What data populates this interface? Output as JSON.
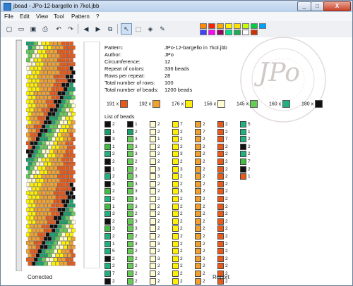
{
  "window": {
    "title": "jbead - JPo-12-bargello in 7kol.jbb",
    "close_label": "X",
    "min_label": "_",
    "max_label": "□"
  },
  "menu": [
    "File",
    "Edit",
    "View",
    "Tool",
    "Pattern",
    "?"
  ],
  "palette": [
    "#ff8800",
    "#ff2200",
    "#ffaa00",
    "#fff000",
    "#ffe000",
    "#c8ff00",
    "#00cc44",
    "#00a0ff",
    "#4040ff",
    "#ff00ff",
    "#990066",
    "#00dd88",
    "#22aa55",
    "#ffffff",
    "#cc3300"
  ],
  "info": {
    "labels": [
      "Pattern:",
      "Author:",
      "Circumference:",
      "Repeat of colors:",
      "Rows per repeat:",
      "Total number of rows:",
      "Total number of beads:"
    ],
    "values": [
      "JPo-12-bargello in 7kol.jbb",
      "JPo",
      "12",
      "336 beads",
      "28",
      "100",
      "1200 beads"
    ]
  },
  "counts": [
    {
      "n": "191 x",
      "c": "#e85a1a"
    },
    {
      "n": "192 x",
      "c": "#f0a030"
    },
    {
      "n": "176 x",
      "c": "#fff000"
    },
    {
      "n": "156 x",
      "c": "#fffcd0"
    },
    {
      "n": "145 x",
      "c": "#66cc55"
    },
    {
      "n": "160 x",
      "c": "#22b080"
    },
    {
      "n": "180 x",
      "c": "#111111"
    }
  ],
  "list_title": "List of beads",
  "bead_list": [
    [
      [
        "#111111",
        "2"
      ],
      [
        "#1aa06a",
        "1"
      ],
      [
        "#111111",
        "3"
      ],
      [
        "#44bb44",
        "1"
      ],
      [
        "#22b080",
        "2"
      ],
      [
        "#111111",
        "2"
      ],
      [
        "#111111",
        "1"
      ],
      [
        "#22b080",
        "2"
      ],
      [
        "#111111",
        "3"
      ],
      [
        "#44bb44",
        "2"
      ],
      [
        "#22b080",
        "2"
      ],
      [
        "#44bb44",
        "1"
      ],
      [
        "#22b080",
        "3"
      ],
      [
        "#111111",
        "2"
      ],
      [
        "#44bb44",
        "3"
      ],
      [
        "#22b080",
        "2"
      ],
      [
        "#22b080",
        "1"
      ],
      [
        "#22b080",
        "5"
      ],
      [
        "#111111",
        "2"
      ],
      [
        "#22b080",
        "2"
      ],
      [
        "#22b080",
        "7"
      ],
      [
        "#111111",
        "2"
      ]
    ],
    [
      [
        "#111111",
        "1"
      ],
      [
        "#1aa06a",
        "2"
      ],
      [
        "#66cc55",
        "3"
      ],
      [
        "#66cc55",
        "3"
      ],
      [
        "#66cc55",
        "3"
      ],
      [
        "#66cc55",
        "2"
      ],
      [
        "#66cc55",
        "2"
      ],
      [
        "#66cc55",
        "3"
      ],
      [
        "#66cc55",
        "3"
      ],
      [
        "#66cc55",
        "3"
      ],
      [
        "#66cc55",
        "3"
      ],
      [
        "#66cc55",
        "3"
      ],
      [
        "#66cc55",
        "2"
      ],
      [
        "#66cc55",
        "3"
      ],
      [
        "#66cc55",
        "3"
      ],
      [
        "#66cc55",
        "2"
      ],
      [
        "#66cc55",
        "3"
      ],
      [
        "#66cc55",
        "2"
      ],
      [
        "#66cc55",
        "2"
      ],
      [
        "#66cc55",
        "2"
      ],
      [
        "#66cc55",
        "2"
      ],
      [
        "#66cc55",
        "2"
      ]
    ],
    [
      [
        "#fffcd0",
        "2"
      ],
      [
        "#fffcd0",
        "2"
      ],
      [
        "#fffcd0",
        "1"
      ],
      [
        "#fffcd0",
        "2"
      ],
      [
        "#fffcd0",
        "2"
      ],
      [
        "#fffcd0",
        "2"
      ],
      [
        "#fffcd0",
        "3"
      ],
      [
        "#fffcd0",
        "3"
      ],
      [
        "#fffcd0",
        "2"
      ],
      [
        "#fffcd0",
        "2"
      ],
      [
        "#fffcd0",
        "2"
      ],
      [
        "#fffcd0",
        "2"
      ],
      [
        "#fffcd0",
        "2"
      ],
      [
        "#fffcd0",
        "2"
      ],
      [
        "#fffcd0",
        "2"
      ],
      [
        "#fffcd0",
        "2"
      ],
      [
        "#fffcd0",
        "3"
      ],
      [
        "#fffcd0",
        "2"
      ],
      [
        "#fffcd0",
        "3"
      ],
      [
        "#fffcd0",
        "2"
      ],
      [
        "#fffcd0",
        "2"
      ],
      [
        "#fffcd0",
        "2"
      ]
    ],
    [
      [
        "#fff000",
        "7"
      ],
      [
        "#fff000",
        "2"
      ],
      [
        "#fff000",
        "2"
      ],
      [
        "#fff000",
        "2"
      ],
      [
        "#fff000",
        "3"
      ],
      [
        "#fff000",
        "2"
      ],
      [
        "#fff000",
        "3"
      ],
      [
        "#fff000",
        "2"
      ],
      [
        "#fff000",
        "2"
      ],
      [
        "#fff000",
        "3"
      ],
      [
        "#fff000",
        "2"
      ],
      [
        "#fff000",
        "2"
      ],
      [
        "#fff000",
        "2"
      ],
      [
        "#fff000",
        "2"
      ],
      [
        "#fff000",
        "2"
      ],
      [
        "#fff000",
        "2"
      ],
      [
        "#fff000",
        "2"
      ],
      [
        "#fff000",
        "2"
      ],
      [
        "#fff000",
        "2"
      ],
      [
        "#fff000",
        "2"
      ],
      [
        "#fff000",
        "2"
      ],
      [
        "#fff000",
        "2"
      ]
    ],
    [
      [
        "#f0a030",
        "2"
      ],
      [
        "#f0a030",
        "7"
      ],
      [
        "#f0a030",
        "2"
      ],
      [
        "#f0a030",
        "2"
      ],
      [
        "#f0a030",
        "2"
      ],
      [
        "#f0a030",
        "2"
      ],
      [
        "#f0a030",
        "2"
      ],
      [
        "#f0a030",
        "2"
      ],
      [
        "#f0a030",
        "2"
      ],
      [
        "#f0a030",
        "2"
      ],
      [
        "#f0a030",
        "2"
      ],
      [
        "#f0a030",
        "2"
      ],
      [
        "#f0a030",
        "2"
      ],
      [
        "#f0a030",
        "2"
      ],
      [
        "#f0a030",
        "2"
      ],
      [
        "#f0a030",
        "2"
      ],
      [
        "#f0a030",
        "2"
      ],
      [
        "#f0a030",
        "2"
      ],
      [
        "#f0a030",
        "2"
      ],
      [
        "#f0a030",
        "2"
      ],
      [
        "#f0a030",
        "2"
      ],
      [
        "#f0a030",
        "2"
      ]
    ],
    [
      [
        "#e85a1a",
        "2"
      ],
      [
        "#e85a1a",
        "2"
      ],
      [
        "#e85a1a",
        "7"
      ],
      [
        "#e85a1a",
        "2"
      ],
      [
        "#e85a1a",
        "2"
      ],
      [
        "#e85a1a",
        "2"
      ],
      [
        "#e85a1a",
        "2"
      ],
      [
        "#e85a1a",
        "2"
      ],
      [
        "#e85a1a",
        "2"
      ],
      [
        "#e85a1a",
        "2"
      ],
      [
        "#e85a1a",
        "2"
      ],
      [
        "#e85a1a",
        "2"
      ],
      [
        "#e85a1a",
        "2"
      ],
      [
        "#e85a1a",
        "2"
      ],
      [
        "#e85a1a",
        "2"
      ],
      [
        "#e85a1a",
        "2"
      ],
      [
        "#e85a1a",
        "2"
      ],
      [
        "#e85a1a",
        "2"
      ],
      [
        "#e85a1a",
        "2"
      ],
      [
        "#e85a1a",
        "2"
      ],
      [
        "#e85a1a",
        "2"
      ],
      [
        "#e85a1a",
        "2"
      ]
    ],
    [
      [
        "#22b080",
        "5"
      ],
      [
        "#22b080",
        "1"
      ],
      [
        "#22b080",
        "2"
      ],
      [
        "#111111",
        "2"
      ],
      [
        "#22b080",
        "2"
      ],
      [
        "#44bb44",
        "7"
      ],
      [
        "#111111",
        "2"
      ],
      [
        "#e85a1a",
        "1"
      ]
    ]
  ],
  "footer": {
    "left": "Corrected",
    "right": "Report"
  },
  "watermark": {
    "text": "JPo",
    "ring": "* jpo-rezodzieło.blogspot.com *"
  }
}
